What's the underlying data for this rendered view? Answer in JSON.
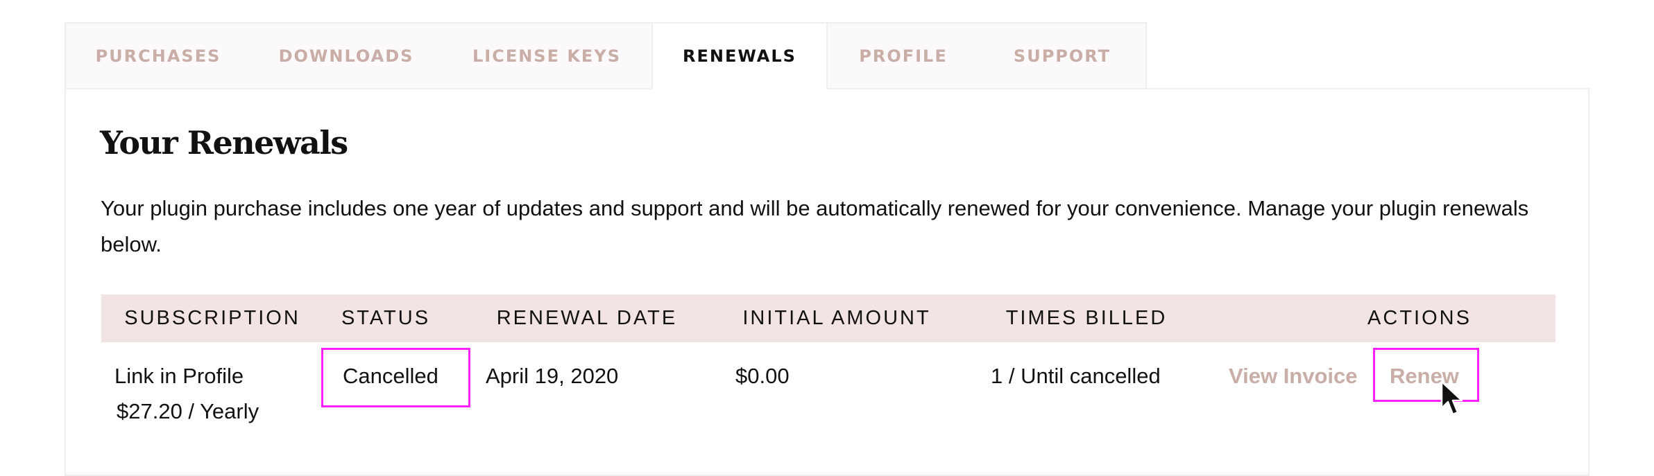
{
  "tabs": [
    {
      "label": "PURCHASES",
      "active": false
    },
    {
      "label": "DOWNLOADS",
      "active": false
    },
    {
      "label": "LICENSE KEYS",
      "active": false
    },
    {
      "label": "RENEWALS",
      "active": true
    },
    {
      "label": "PROFILE",
      "active": false
    },
    {
      "label": "SUPPORT",
      "active": false
    }
  ],
  "page": {
    "title": "Your Renewals",
    "intro": "Your plugin purchase includes one year of updates and support and will be automatically renewed for your convenience. Manage your plugin renewals below."
  },
  "table": {
    "headers": [
      "SUBSCRIPTION",
      "STATUS",
      "RENEWAL DATE",
      "INITIAL AMOUNT",
      "TIMES BILLED",
      "ACTIONS"
    ],
    "rows": [
      {
        "subscription_name": "Link in Profile",
        "subscription_price": "$27.20 / Yearly",
        "status": "Cancelled",
        "renewal_date": "April 19, 2020",
        "initial_amount": "$0.00",
        "times_billed": "1 / Until cancelled",
        "actions": {
          "view_invoice": "View Invoice",
          "renew": "Renew"
        }
      }
    ]
  },
  "colors": {
    "accent_muted": "#c9ada7",
    "header_bg": "#f2e4e2",
    "highlight": "#ff22ff",
    "text": "#111111"
  },
  "icons": {
    "cursor": "mouse-pointer-icon"
  }
}
